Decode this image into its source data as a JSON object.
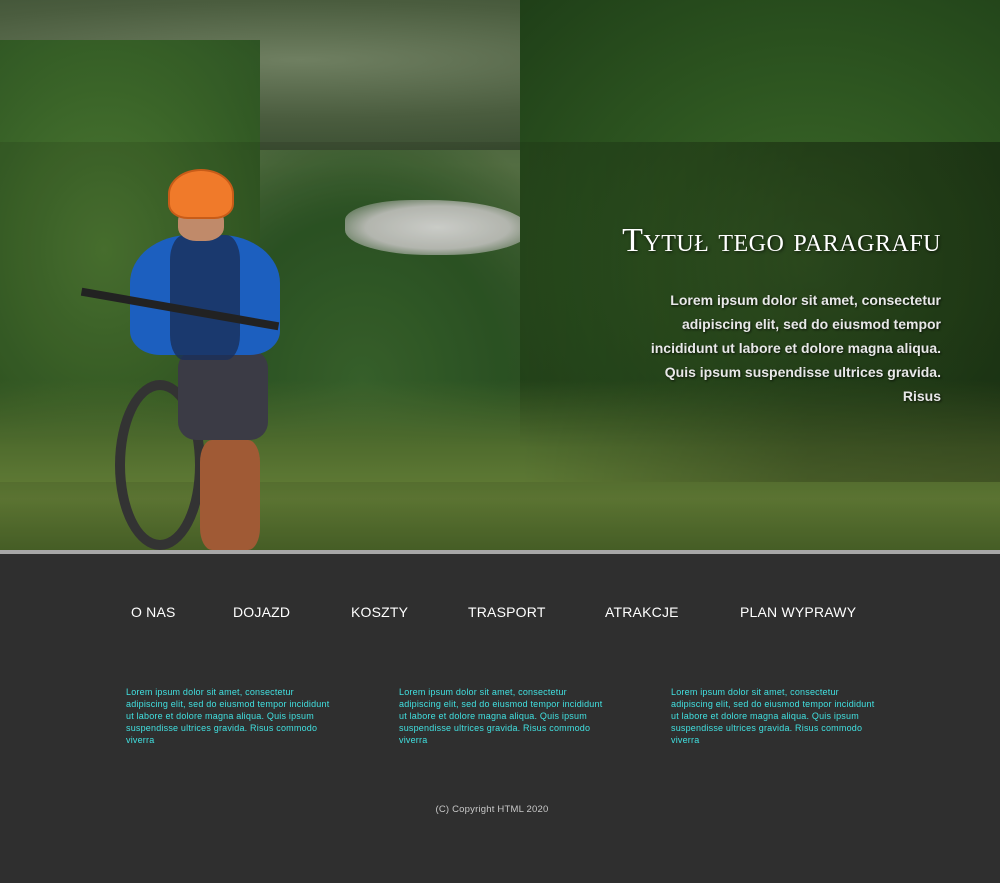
{
  "hero": {
    "title": "Tytuł tego paragrafu",
    "text": "Lorem ipsum dolor sit amet, consectetur adipiscing elit, sed do eiusmod tempor incididunt ut labore et dolore magna aliqua. Quis ipsum suspendisse ultrices gravida. Risus"
  },
  "nav": {
    "items": [
      {
        "label": "O NAS"
      },
      {
        "label": "DOJAZD"
      },
      {
        "label": "KOSZTY"
      },
      {
        "label": "TRASPORT"
      },
      {
        "label": "ATRAKCJE"
      },
      {
        "label": "PLAN WYPRAWY"
      }
    ]
  },
  "columns": [
    {
      "text": "Lorem ipsum dolor sit amet, consectetur adipiscing elit, sed do eiusmod tempor incididunt ut labore et dolore magna aliqua. Quis ipsum suspendisse ultrices gravida. Risus commodo viverra"
    },
    {
      "text": "Lorem ipsum dolor sit amet, consectetur adipiscing elit, sed do eiusmod tempor incididunt ut labore et dolore magna aliqua. Quis ipsum suspendisse ultrices gravida. Risus commodo viverra"
    },
    {
      "text": "Lorem ipsum dolor sit amet, consectetur adipiscing elit, sed do eiusmod tempor incididunt ut labore et dolore magna aliqua. Quis ipsum suspendisse ultrices gravida. Risus commodo viverra"
    }
  ],
  "footer": {
    "copyright": "(C) Copyright HTML 2020"
  },
  "colors": {
    "background": "#2f2f2f",
    "divider": "#a7a7a7",
    "column_text": "#41e0e0",
    "nav_text": "#ffffff"
  }
}
